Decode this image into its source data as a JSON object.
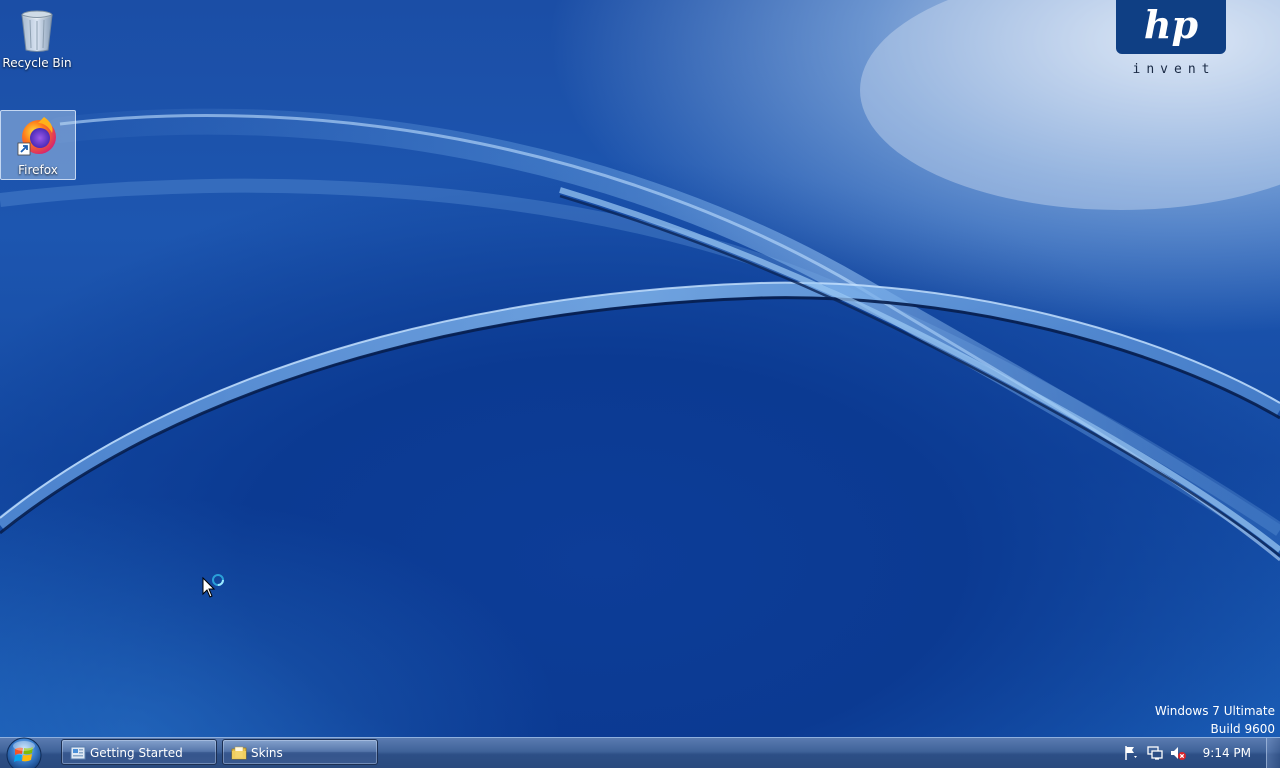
{
  "desktop": {
    "icons": [
      {
        "label": "Recycle Bin",
        "icon": "recycle-bin-icon"
      },
      {
        "label": "Firefox",
        "icon": "firefox-icon"
      }
    ],
    "logo": {
      "brand": "hp",
      "tagline": "invent"
    },
    "watermark": {
      "line1": "Windows 7 Ultimate",
      "line2": "Build 9600"
    }
  },
  "taskbar": {
    "start_icon": "windows-start-orb-icon",
    "buttons": [
      {
        "label": "Getting Started",
        "icon": "getting-started-icon"
      },
      {
        "label": "Skins",
        "icon": "folder-icon"
      }
    ],
    "tray": {
      "icons": [
        "action-center-flag-icon",
        "network-icon",
        "volume-muted-icon"
      ],
      "clock": "9:14 PM"
    }
  },
  "colors": {
    "wallpaper_blue": "#1b4ea6",
    "taskbar": "#2d4f86",
    "hp_blue": "#0f3f84"
  }
}
